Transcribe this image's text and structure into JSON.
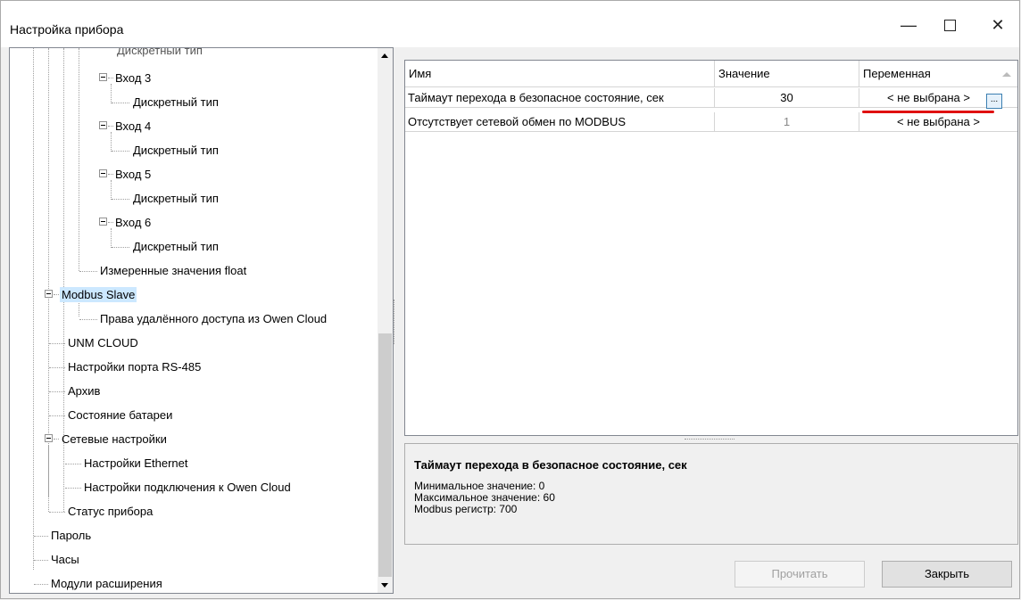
{
  "window": {
    "title": "Настройка прибора",
    "minimize": "—",
    "close": "✕"
  },
  "tree": {
    "items": [
      {
        "label": "Дискретный тип",
        "partial": true
      },
      {
        "label": "Вход 3"
      },
      {
        "label": "Дискретный тип"
      },
      {
        "label": "Вход 4"
      },
      {
        "label": "Дискретный тип"
      },
      {
        "label": "Вход 5"
      },
      {
        "label": "Дискретный тип"
      },
      {
        "label": "Вход 6"
      },
      {
        "label": "Дискретный тип"
      },
      {
        "label": "Измеренные значения float"
      },
      {
        "label": "Modbus Slave",
        "selected": true
      },
      {
        "label": "Права удалённого доступа из Owen Cloud"
      },
      {
        "label": "UNM CLOUD"
      },
      {
        "label": "Настройки порта RS-485"
      },
      {
        "label": "Архив"
      },
      {
        "label": "Состояние батареи"
      },
      {
        "label": "Сетевые настройки"
      },
      {
        "label": "Настройки Ethernet"
      },
      {
        "label": "Настройки подключения к Owen Cloud"
      },
      {
        "label": "Статус прибора"
      },
      {
        "label": "Пароль"
      },
      {
        "label": "Часы"
      },
      {
        "label": "Модули расширения"
      }
    ]
  },
  "grid": {
    "headers": {
      "name": "Имя",
      "value": "Значение",
      "variable": "Переменная"
    },
    "rows": [
      {
        "name": "Таймаут перехода в безопасное состояние, сек",
        "value": "30",
        "variable": "< не выбрана >"
      },
      {
        "name": "Отсутствует сетевой обмен по MODBUS",
        "value": "1",
        "variable": "< не выбрана >"
      }
    ],
    "ellipsis": "..."
  },
  "info": {
    "title": "Таймаут перехода в безопасное состояние, сек",
    "min": "Минимальное значение: 0",
    "max": "Максимальное значение: 60",
    "register": "Modbus регистр: 700"
  },
  "buttons": {
    "read": "Прочитать",
    "close": "Закрыть"
  },
  "colors": {
    "selection": "#cce8ff",
    "highlight_underline": "#e01010"
  }
}
